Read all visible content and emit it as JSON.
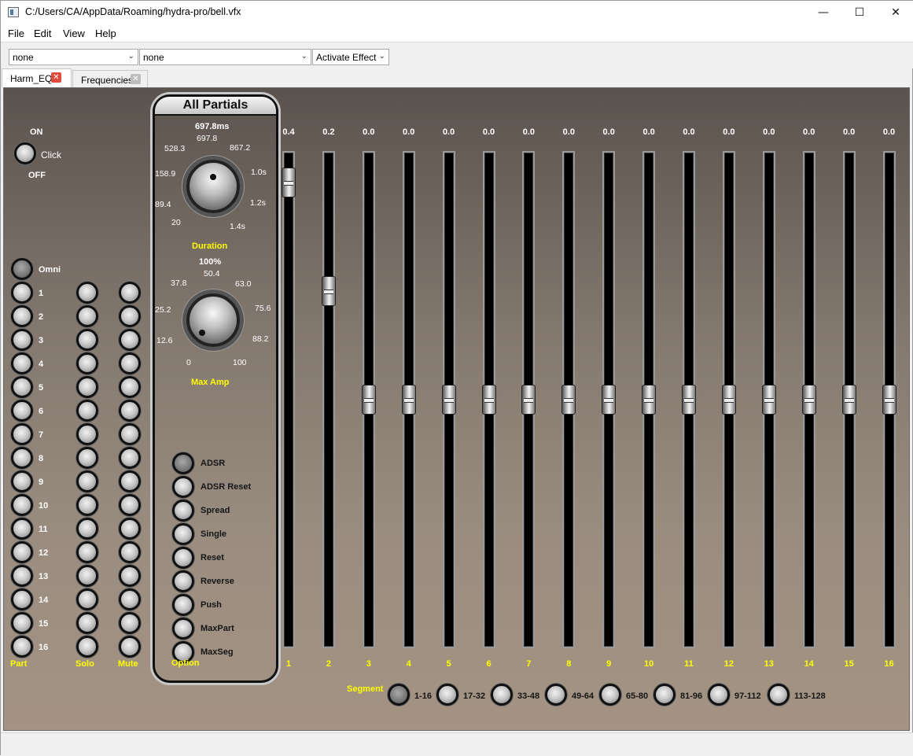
{
  "window": {
    "title": "C:/Users/CA/AppData/Roaming/hydra-pro/bell.vfx",
    "minimize": "—",
    "maximize": "☐",
    "close": "✕"
  },
  "menu": [
    "File",
    "Edit",
    "View",
    "Help"
  ],
  "toolbar": {
    "combo1": "none",
    "combo2": "none",
    "combo3": "Activate Effect"
  },
  "tabs": [
    {
      "label": "Harm_EQ",
      "active": true
    },
    {
      "label": "Frequencies",
      "active": false
    }
  ],
  "onoff": {
    "on": "ON",
    "off": "OFF",
    "click": "Click"
  },
  "omni": "Omni",
  "parts": [
    "1",
    "2",
    "3",
    "4",
    "5",
    "6",
    "7",
    "8",
    "9",
    "10",
    "11",
    "12",
    "13",
    "14",
    "15",
    "16"
  ],
  "column_labels": {
    "part": "Part",
    "solo": "Solo",
    "mute": "Mute",
    "option": "Option"
  },
  "all_partials": {
    "title": "All Partials",
    "duration": {
      "value": "697.8ms",
      "label": "Duration",
      "ticks": [
        "20",
        "89.4",
        "158.9",
        "528.3",
        "697.8",
        "867.2",
        "1.0s",
        "1.2s",
        "1.4s"
      ]
    },
    "max_amp": {
      "value": "100%",
      "label": "Max Amp",
      "ticks": [
        "0",
        "12.6",
        "25.2",
        "37.8",
        "50.4",
        "63.0",
        "75.6",
        "88.2",
        "100"
      ]
    },
    "options": [
      "ADSR",
      "ADSR Reset",
      "Spread",
      "Single",
      "Reset",
      "Reverse",
      "Push",
      "MaxPart",
      "MaxSeg"
    ]
  },
  "faders": {
    "values": [
      "0.4",
      "0.2",
      "0.0",
      "0.0",
      "0.0",
      "0.0",
      "0.0",
      "0.0",
      "0.0",
      "0.0",
      "0.0",
      "0.0",
      "0.0",
      "0.0",
      "0.0",
      "0.0"
    ],
    "levels": [
      0.4,
      0.2,
      0,
      0,
      0,
      0,
      0,
      0,
      0,
      0,
      0,
      0,
      0,
      0,
      0,
      0
    ],
    "labels": [
      "1",
      "2",
      "3",
      "4",
      "5",
      "6",
      "7",
      "8",
      "9",
      "10",
      "11",
      "12",
      "13",
      "14",
      "15",
      "16"
    ]
  },
  "segment": {
    "label": "Segment",
    "items": [
      "1-16",
      "17-32",
      "33-48",
      "49-64",
      "65-80",
      "81-96",
      "97-112",
      "113-128"
    ]
  },
  "colors": {
    "accent": "#ffff00",
    "panel_top": "#5a534d",
    "panel_bottom": "#a49382"
  }
}
